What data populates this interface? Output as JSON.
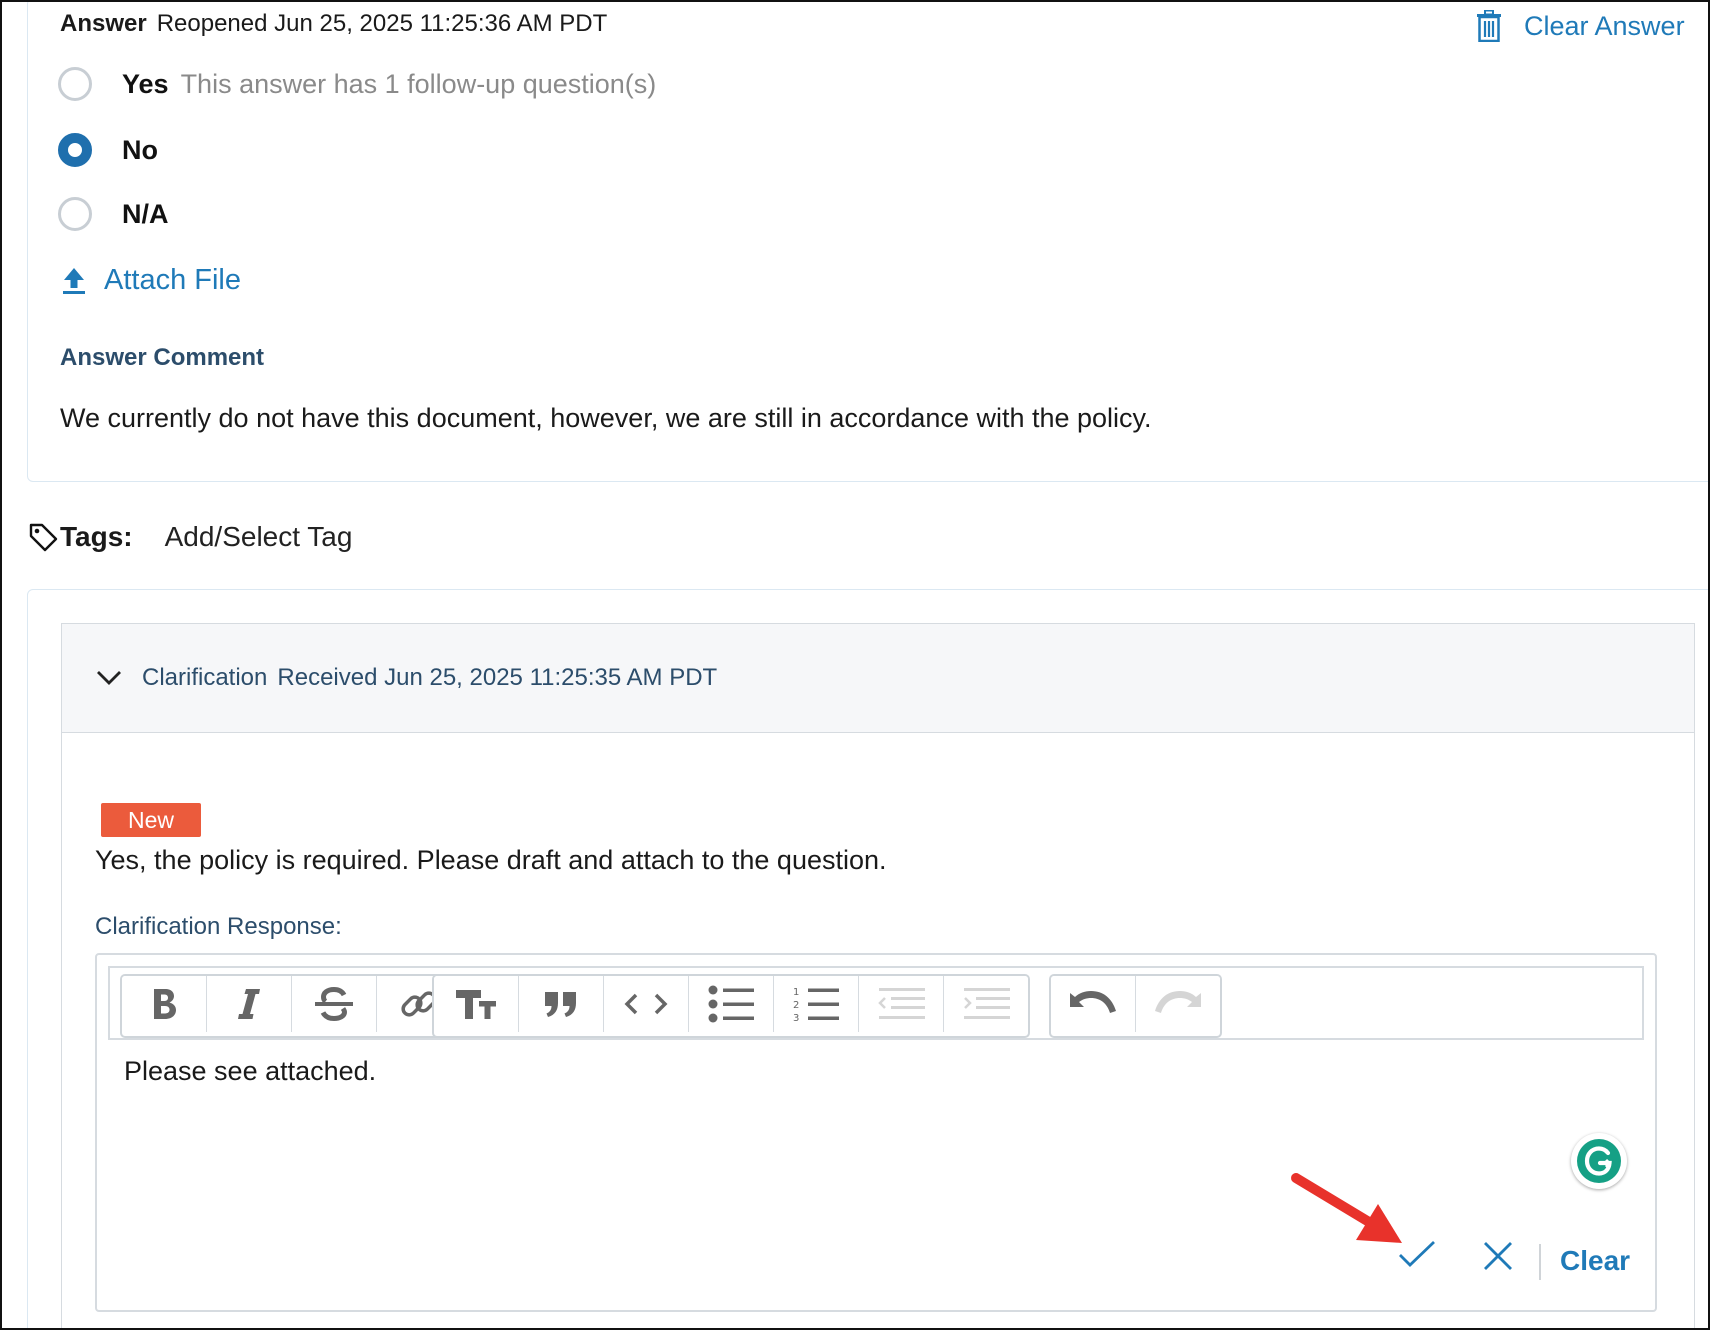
{
  "answer": {
    "label": "Answer",
    "status": "Reopened Jun 25, 2025 11:25:36 AM PDT",
    "clear_label": "Clear Answer",
    "options": [
      {
        "label": "Yes",
        "hint": "This answer has 1 follow-up question(s)",
        "checked": false
      },
      {
        "label": "No",
        "hint": "",
        "checked": true
      },
      {
        "label": "N/A",
        "hint": "",
        "checked": false
      }
    ],
    "attach_label": "Attach File",
    "comment_label": "Answer Comment",
    "comment_text": "We currently do not have this document, however, we are still in accordance with the policy."
  },
  "tags": {
    "label": "Tags:",
    "action": "Add/Select Tag"
  },
  "clarification": {
    "title": "Clarification",
    "received": "Received Jun 25, 2025 11:25:35 AM PDT",
    "badge": "New",
    "text": "Yes, the policy is required. Please draft and attach to the question.",
    "response_label": "Clarification Response:",
    "response_text": "Please see attached.",
    "clear_label": "Clear"
  },
  "colors": {
    "accent": "#1f7ab8",
    "radio_checked": "#1f6fad",
    "badge": "#eb5b3c",
    "annotation_arrow": "#e8322b"
  },
  "icons": [
    "trash-icon",
    "upload-icon",
    "tag-icon",
    "chevron-down-icon",
    "bold-icon",
    "italic-icon",
    "strikethrough-icon",
    "link-icon",
    "heading-icon",
    "quote-icon",
    "code-icon",
    "bullet-list-icon",
    "numbered-list-icon",
    "outdent-icon",
    "indent-icon",
    "undo-icon",
    "redo-icon",
    "grammarly-icon",
    "check-icon",
    "close-icon"
  ]
}
